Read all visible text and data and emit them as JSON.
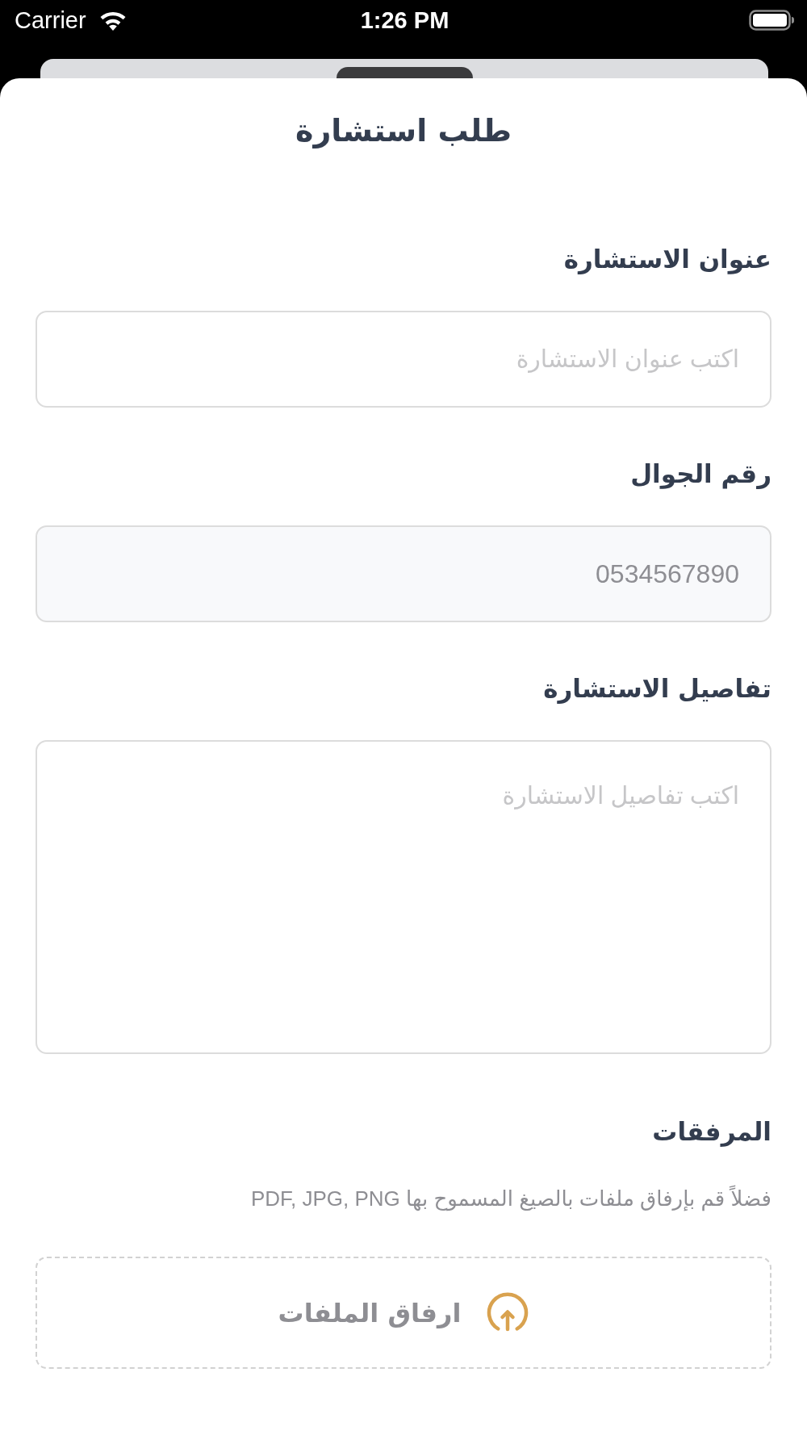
{
  "status_bar": {
    "carrier": "Carrier",
    "time": "1:26 PM"
  },
  "sheet": {
    "title": "طلب استشارة"
  },
  "fields": [
    {
      "kind": "input",
      "label": "عنوان الاستشارة",
      "placeholder": "اكتب عنوان الاستشارة",
      "disabled": false
    },
    {
      "kind": "input",
      "label": "رقم الجوال",
      "value": "0534567890",
      "disabled": true
    },
    {
      "kind": "textarea",
      "label": "تفاصيل الاستشارة",
      "placeholder": "اكتب تفاصيل الاستشارة",
      "disabled": false
    }
  ],
  "attachments": {
    "label": "المرفقات",
    "hint": "فضلاً قم بإرفاق ملفات بالصيغ المسموح بها PDF, JPG, PNG",
    "button": "ارفاق الملفات"
  }
}
